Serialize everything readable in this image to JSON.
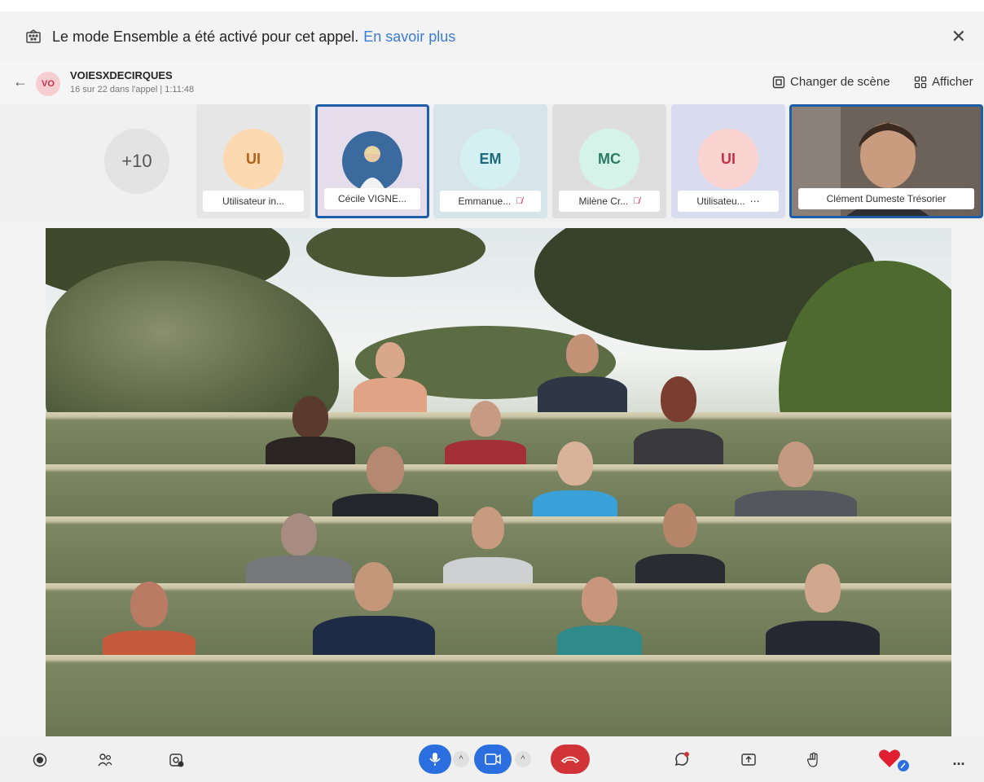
{
  "banner": {
    "message": "Le mode Ensemble a été activé pour cet appel.",
    "link": "En savoir plus"
  },
  "header": {
    "avatar_initials": "VO",
    "title": "VOIESXDECIRQUES",
    "subtitle": "16 sur 22 dans l'appel | 1:11:48",
    "change_scene": "Changer de scène",
    "view": "Afficher"
  },
  "participants": {
    "overflow": "+10",
    "tiles": [
      {
        "initials": "UI",
        "label": "Utilisateur in...",
        "muted": false,
        "more": false,
        "selected": false,
        "bg": "#e6e6e6",
        "circle": "#fcd9b0",
        "text": "#b5611c"
      },
      {
        "initials": "",
        "label": "Cécile VIGNE...",
        "muted": false,
        "more": false,
        "selected": true,
        "bg": "#e5dcec",
        "circle": "#3b6a9e",
        "text": "#ffffff"
      },
      {
        "initials": "EM",
        "label": "Emmanue...",
        "muted": true,
        "more": false,
        "selected": false,
        "bg": "#d7e5ea",
        "circle": "#d5f0f2",
        "text": "#1e6a7a"
      },
      {
        "initials": "MC",
        "label": "Milène Cr...",
        "muted": true,
        "more": false,
        "selected": false,
        "bg": "#dedede",
        "circle": "#d6f3ea",
        "text": "#2b7a62"
      },
      {
        "initials": "UI",
        "label": "Utilisateu...",
        "muted": false,
        "more": true,
        "selected": false,
        "bg": "#d9dcef",
        "circle": "#fbd3d0",
        "text": "#c4314b"
      },
      {
        "initials": "",
        "label": "Clément Dumeste Trésorier",
        "muted": false,
        "more": false,
        "selected": true,
        "bg": "#5b5049",
        "circle": "",
        "text": ""
      }
    ]
  },
  "toolbar": {
    "record_icon": "record-icon",
    "people_icon": "people-icon",
    "camera_settings_icon": "camera-settings-icon",
    "mic_icon": "mic-icon",
    "video_icon": "video-icon",
    "hangup_icon": "hangup-icon",
    "chat_icon": "chat-icon",
    "share_icon": "share-icon",
    "hand_icon": "raise-hand-icon",
    "reaction_icon": "heart-icon",
    "more_label": "...",
    "colors": {
      "mic": "#2b6ee0",
      "hangup": "#d13438",
      "heart": "#e02030"
    }
  }
}
